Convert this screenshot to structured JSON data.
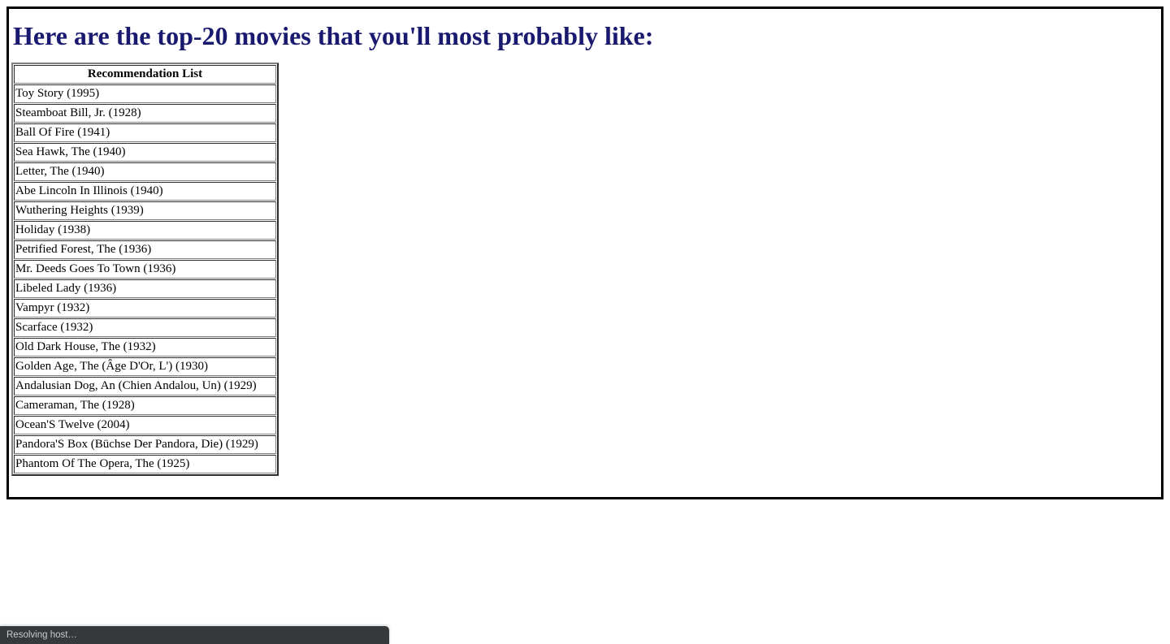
{
  "page": {
    "heading": "Here are the top-20 movies that you'll most probably like:"
  },
  "table": {
    "header": "Recommendation List",
    "rows": [
      "Toy Story (1995)",
      "Steamboat Bill, Jr. (1928)",
      "Ball Of Fire (1941)",
      "Sea Hawk, The (1940)",
      "Letter, The (1940)",
      "Abe Lincoln In Illinois (1940)",
      "Wuthering Heights (1939)",
      "Holiday (1938)",
      "Petrified Forest, The (1936)",
      "Mr. Deeds Goes To Town (1936)",
      "Libeled Lady (1936)",
      "Vampyr (1932)",
      "Scarface (1932)",
      "Old Dark House, The (1932)",
      "Golden Age, The (Âge D'Or, L') (1930)",
      "Andalusian Dog, An (Chien Andalou, Un) (1929)",
      "Cameraman, The (1928)",
      "Ocean'S Twelve (2004)",
      "Pandora'S Box (Büchse Der Pandora, Die) (1929)",
      "Phantom Of The Opera, The (1925)"
    ]
  },
  "status": {
    "text": "Resolving host…"
  },
  "colors": {
    "heading": "#191970",
    "frame_border": "#000000",
    "status_background": "#36393c",
    "status_text": "#c8cbcd"
  }
}
